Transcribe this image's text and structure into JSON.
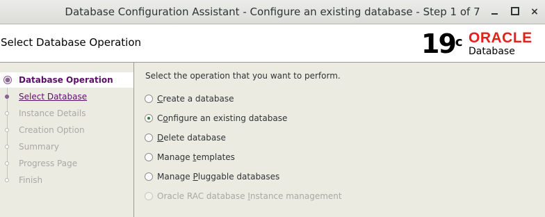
{
  "window": {
    "title": "Database Configuration Assistant - Configure an existing database - Step 1 of 7",
    "controls": {
      "minimize": "minimize",
      "maximize": "maximize",
      "close": "×"
    }
  },
  "header": {
    "page_title": "Select Database Operation",
    "brand": {
      "version": "19",
      "version_suffix": "c",
      "vendor": "ORACLE",
      "product": "Database"
    }
  },
  "nav": {
    "items": [
      {
        "label": "Database Operation",
        "state": "active"
      },
      {
        "label": "Select Database",
        "state": "link"
      },
      {
        "label": "Instance Details",
        "state": "disabled"
      },
      {
        "label": "Creation Option",
        "state": "disabled"
      },
      {
        "label": "Summary",
        "state": "disabled"
      },
      {
        "label": "Progress Page",
        "state": "disabled"
      },
      {
        "label": "Finish",
        "state": "disabled"
      }
    ]
  },
  "main": {
    "prompt": "Select the operation that you want to perform.",
    "options": [
      {
        "pre": "",
        "mnemonic": "C",
        "post": "reate a database",
        "checked": false,
        "enabled": true
      },
      {
        "pre": "C",
        "mnemonic": "o",
        "post": "nfigure an existing database",
        "checked": true,
        "enabled": true
      },
      {
        "pre": "",
        "mnemonic": "D",
        "post": "elete database",
        "checked": false,
        "enabled": true
      },
      {
        "pre": "Manage ",
        "mnemonic": "t",
        "post": "emplates",
        "checked": false,
        "enabled": true
      },
      {
        "pre": "Manage ",
        "mnemonic": "P",
        "post": "luggable databases",
        "checked": false,
        "enabled": true
      },
      {
        "pre": "Oracle RAC database ",
        "mnemonic": "I",
        "post": "nstance management",
        "checked": false,
        "enabled": false
      }
    ]
  },
  "colors": {
    "accent": "#5b1067",
    "oracle_red": "#e2231a",
    "radio_selected": "#2e7d32",
    "background": "#ecebe2"
  }
}
